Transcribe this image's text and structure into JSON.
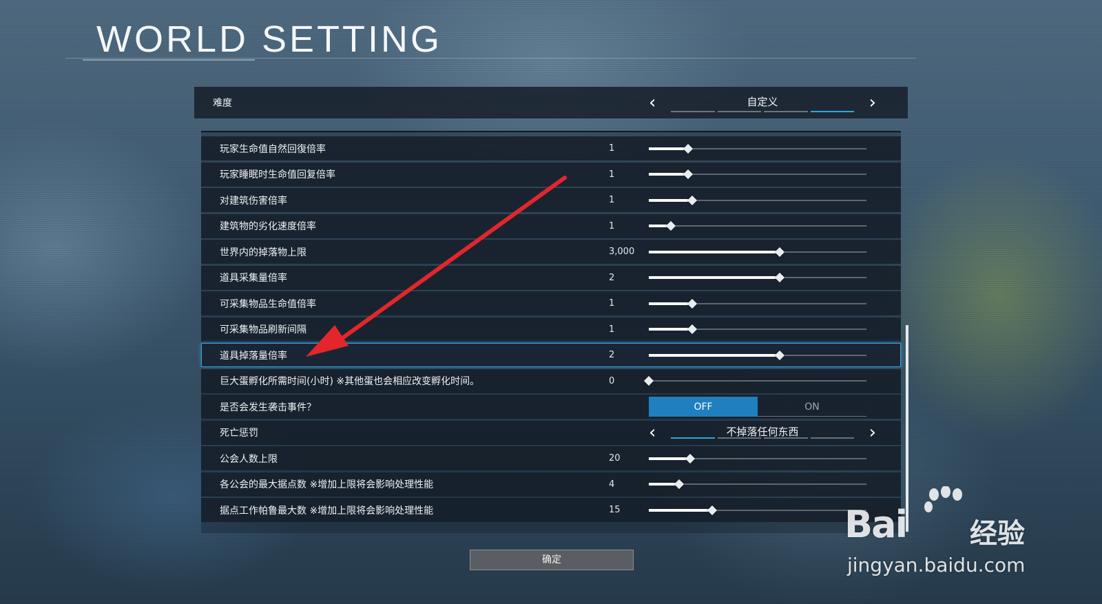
{
  "page_title": "WORLD SETTING",
  "difficulty": {
    "label": "难度",
    "value": "自定义",
    "segments": 4,
    "active_segment": 3
  },
  "settings": [
    {
      "label": "玩家生命值自然回復倍率",
      "value": "1",
      "fraction": 0.18
    },
    {
      "label": "玩家睡眠时生命值回复倍率",
      "value": "1",
      "fraction": 0.18
    },
    {
      "label": "对建筑伤害倍率",
      "value": "1",
      "fraction": 0.2
    },
    {
      "label": "建筑物的劣化速度倍率",
      "value": "1",
      "fraction": 0.1
    },
    {
      "label": "世界内的掉落物上限",
      "value": "3,000",
      "fraction": 0.6
    },
    {
      "label": "道具采集量倍率",
      "value": "2",
      "fraction": 0.6
    },
    {
      "label": "可采集物品生命值倍率",
      "value": "1",
      "fraction": 0.2
    },
    {
      "label": "可采集物品刷新间隔",
      "value": "1",
      "fraction": 0.2
    },
    {
      "label": "道具掉落量倍率",
      "value": "2",
      "fraction": 0.6,
      "highlighted": true
    },
    {
      "label": "巨大蛋孵化所需时间(小时) ※其他蛋也会相应改变孵化时间。",
      "value": "0",
      "fraction": 0.0
    }
  ],
  "raid_event": {
    "label": "是否会发生袭击事件？",
    "off_label": "OFF",
    "on_label": "ON",
    "selected": "OFF"
  },
  "death_penalty": {
    "label": "死亡惩罚",
    "value": "不掉落任何东西",
    "segments": 4,
    "active_segment": 0
  },
  "settings_lower": [
    {
      "label": "公会人数上限",
      "value": "20",
      "fraction": 0.19
    },
    {
      "label": "各公会的最大据点数 ※增加上限将会影响处理性能",
      "value": "4",
      "fraction": 0.14
    },
    {
      "label": "据点工作帕鲁最大数 ※增加上限将会影响处理性能",
      "value": "15",
      "fraction": 0.29
    }
  ],
  "confirm_label": "确定",
  "watermark": {
    "brand": "Bai",
    "brand_cn": "经验",
    "url": "jingyan.baidu.com"
  },
  "colors": {
    "accent": "#2fa6e6",
    "toggle_on": "#1f7fbf",
    "annotation_arrow": "#e3262b"
  }
}
